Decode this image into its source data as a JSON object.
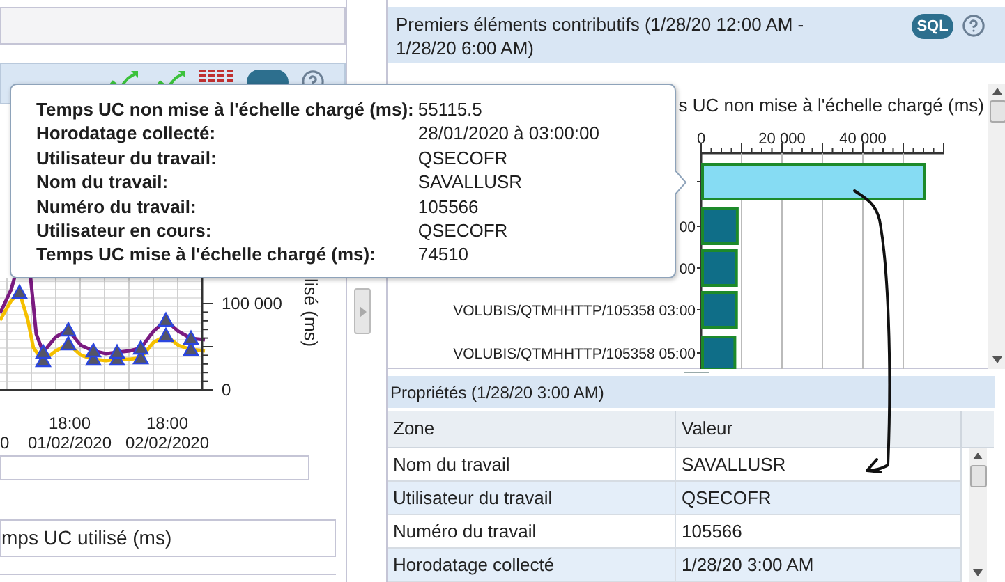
{
  "left_panel": {
    "chart": {
      "y_ticks": [
        "100 000",
        "0"
      ],
      "axis_title": "lisé (ms)",
      "x_labels": [
        {
          "date": "0"
        },
        {
          "time": "18:00",
          "date": "01/02/2020"
        },
        {
          "time": "18:00",
          "date": "02/02/2020"
        }
      ]
    },
    "metric_field": {
      "value": "mps UC utilisé (ms)"
    }
  },
  "right_panel": {
    "title": "Premiers éléments contributifs (1/28/20 12:00 AM - 1/28/20 6:00 AM)",
    "sql_label": "SQL",
    "top_chart": {
      "bars": [
        {
          "selected": true
        },
        {
          "selected": false
        },
        {
          "selected": false
        },
        {
          "selected": false
        },
        {
          "selected": false
        }
      ],
      "chart_data": {
        "type": "bar",
        "orientation": "horizontal",
        "title": "s UC non mise à l'échelle chargé (ms)",
        "categories": [
          null,
          "00",
          "00",
          "VOLUBIS/QTMHHTTP/105358 03:00",
          "VOLUBIS/QTMHHTTP/105358 05:00"
        ],
        "values": [
          55000,
          8600,
          8400,
          8400,
          8000
        ],
        "xlim": [
          0,
          60000
        ],
        "xticks": [
          {
            "value": 0,
            "label": "0"
          },
          {
            "value": 20000,
            "label": "20 000"
          },
          {
            "value": 40000,
            "label": "40 000"
          }
        ]
      }
    }
  },
  "properties": {
    "title": "Propriétés (1/28/20 3:00 AM)",
    "columns": [
      "Zone",
      "Valeur"
    ],
    "rows": [
      [
        "Nom du travail",
        "SAVALLUSR"
      ],
      [
        "Utilisateur du travail",
        "QSECOFR"
      ],
      [
        "Numéro du travail",
        "105566"
      ],
      [
        "Horodatage collecté",
        "1/28/20 3:00 AM"
      ]
    ]
  },
  "tooltip": {
    "rows": [
      {
        "label": "Temps UC non mise à l'échelle chargé (ms):",
        "value": "55115.5"
      },
      {
        "label": "Horodatage collecté:",
        "value": "28/01/2020 à 03:00:00"
      },
      {
        "label": "Utilisateur du travail:",
        "value": "QSECOFR"
      },
      {
        "label": "Nom du travail:",
        "value": "SAVALLUSR"
      },
      {
        "label": "Numéro du travail:",
        "value": "105566"
      },
      {
        "label": "Utilisateur en cours:",
        "value": "QSECOFR"
      },
      {
        "label": "Temps UC mise à l'échelle chargé (ms):",
        "value": "74510"
      }
    ]
  }
}
